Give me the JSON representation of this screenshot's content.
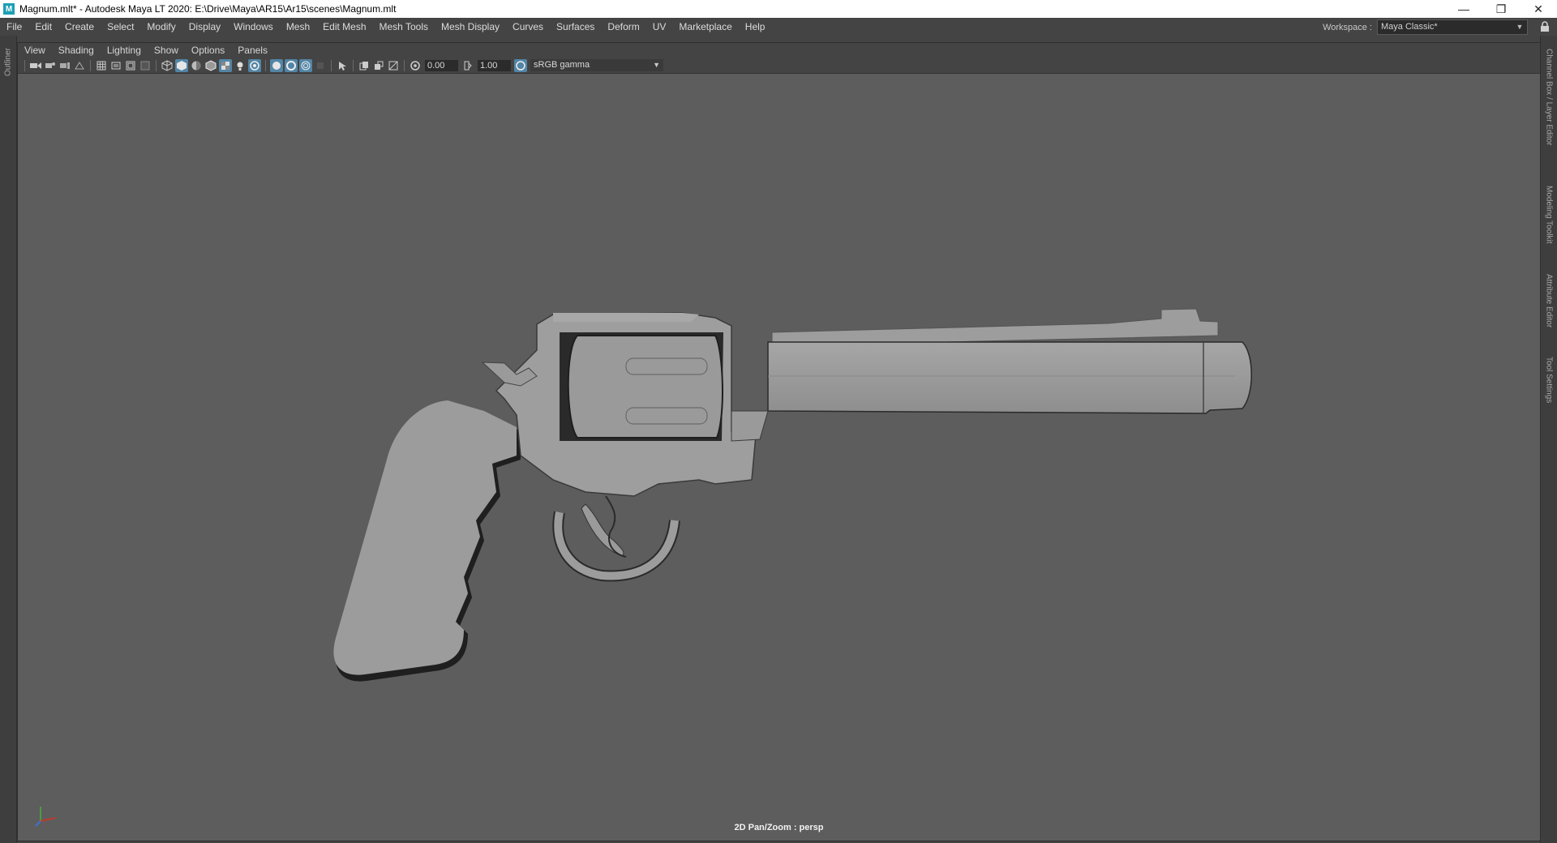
{
  "window": {
    "title": "Magnum.mlt* - Autodesk Maya LT 2020: E:\\Drive\\Maya\\AR15\\Ar15\\scenes\\Magnum.mlt",
    "logo_letter": "M",
    "controls": {
      "minimize": "—",
      "maximize": "❐",
      "close": "✕"
    }
  },
  "menubar": {
    "items": [
      "File",
      "Edit",
      "Create",
      "Select",
      "Modify",
      "Display",
      "Windows",
      "Mesh",
      "Edit Mesh",
      "Mesh Tools",
      "Mesh Display",
      "Curves",
      "Surfaces",
      "Deform",
      "UV",
      "Marketplace",
      "Help"
    ],
    "workspace_label": "Workspace :",
    "workspace_value": "Maya Classic*"
  },
  "left_tabs": [
    "Outliner"
  ],
  "right_tabs": [
    "Channel Box / Layer Editor",
    "Modeling Toolkit",
    "Attribute Editor",
    "Tool Settings"
  ],
  "panel": {
    "menu": [
      "View",
      "Shading",
      "Lighting",
      "Show",
      "Options",
      "Panels"
    ],
    "toolbar": {
      "exposure_value": "0.00",
      "gamma_value": "1.00",
      "color_space": "sRGB gamma"
    },
    "camera_label": "2D Pan/Zoom : persp"
  },
  "colors": {
    "viewport_bg": "#5d5d5d",
    "ui_bg": "#444444",
    "accent": "#5285a6",
    "model": "#9c9c9c"
  }
}
